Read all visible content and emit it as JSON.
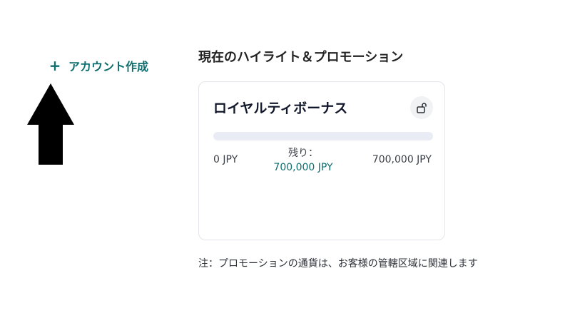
{
  "left": {
    "create_account_label": "アカウント作成",
    "create_account_icon": "plus-icon"
  },
  "promotions": {
    "section_title": "現在のハイライト＆プロモーション",
    "card": {
      "title": "ロイヤルティボーナス",
      "lock_icon": "unlock-icon",
      "progress_fraction": 0,
      "min_label": "0 JPY",
      "remaining_label": "残り：",
      "remaining_value": "700,000 JPY",
      "max_label": "700,000 JPY"
    },
    "note": "注：プロモーションの通貨は、お客様の管轄区域に関連します"
  },
  "colors": {
    "accent": "#0f6e6e",
    "progress_track": "#e9ecf4",
    "arrow": "#000000"
  }
}
